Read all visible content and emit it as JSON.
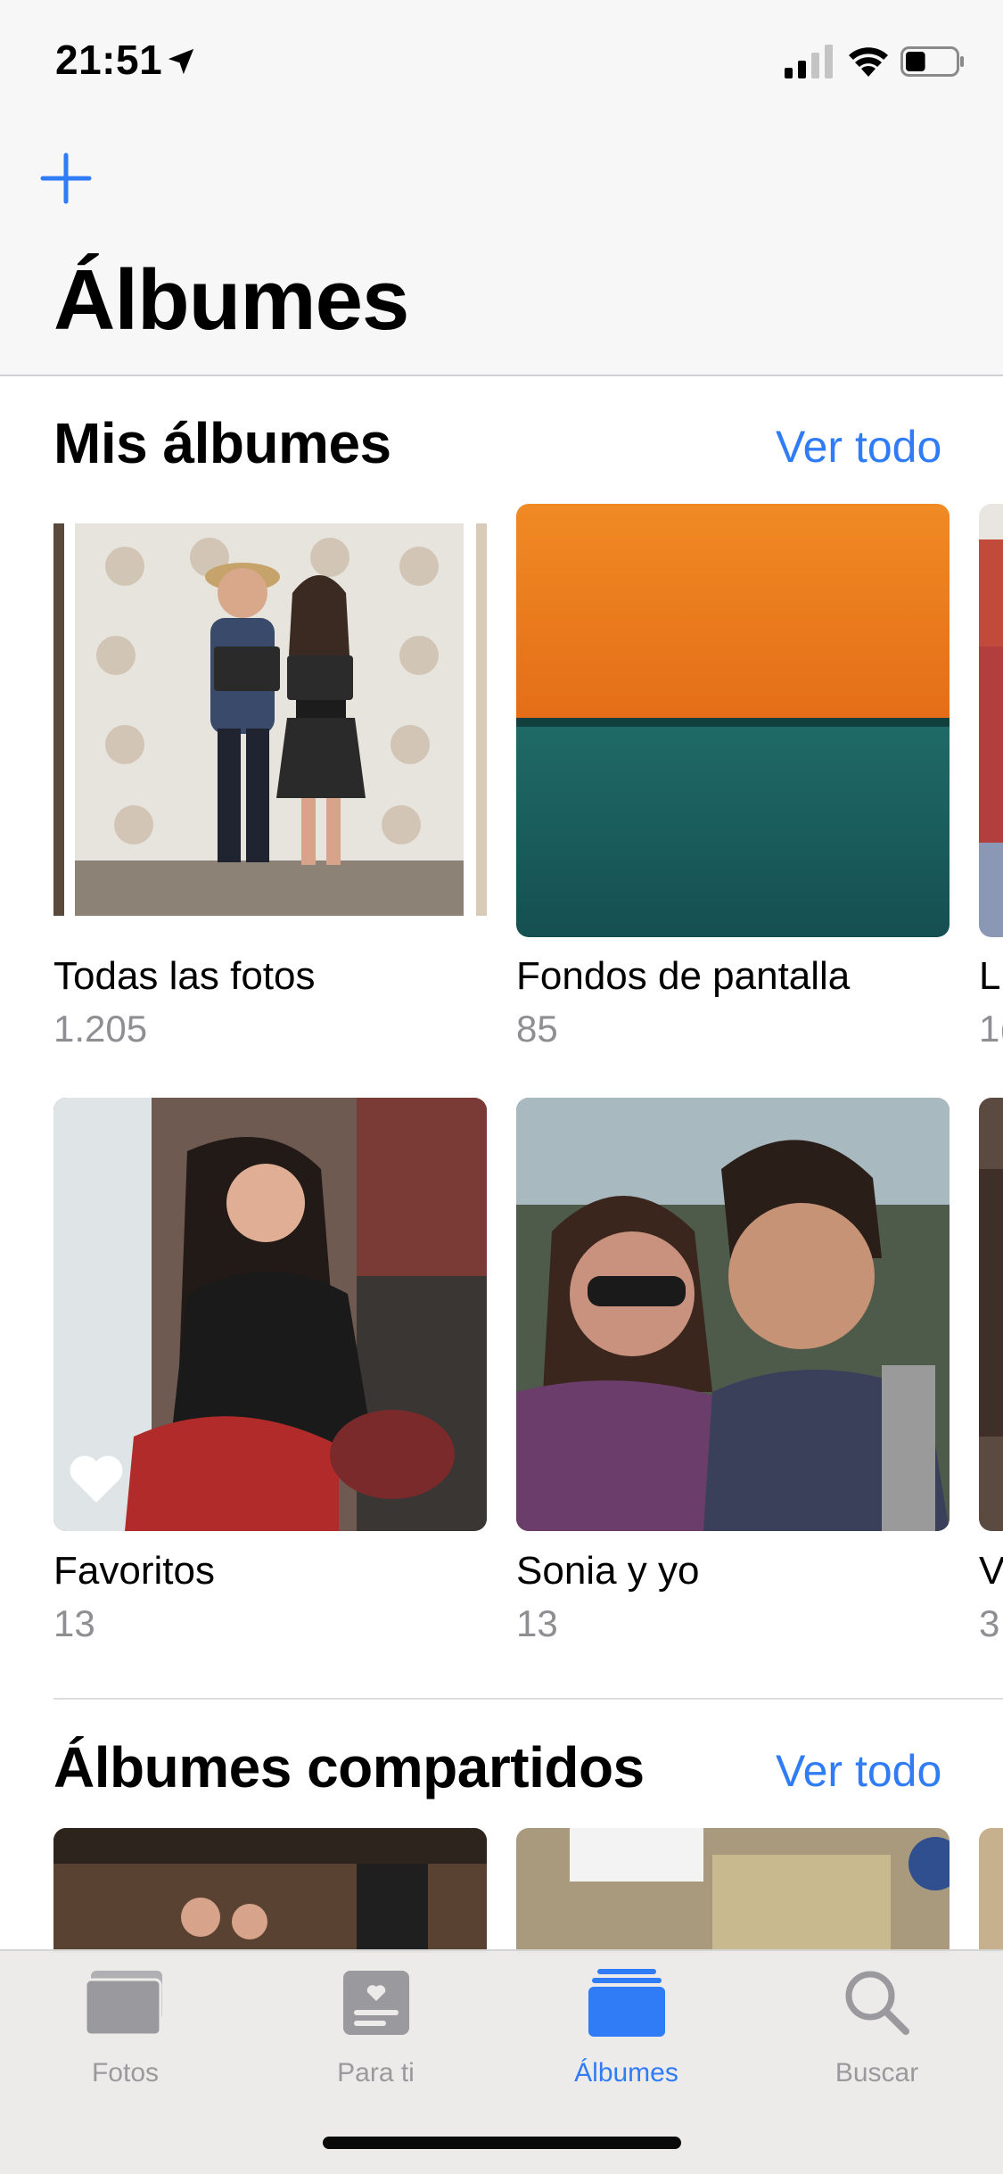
{
  "status_bar": {
    "time": "21:51",
    "battery_level": 0.4
  },
  "header": {
    "title": "Álbumes"
  },
  "my_albums": {
    "title": "Mis álbumes",
    "see_all": "Ver todo",
    "albums": [
      {
        "name": "Todas las fotos",
        "count": "1.205"
      },
      {
        "name": "Fondos de pantalla",
        "count": "85"
      },
      {
        "name": "L",
        "count": "1("
      },
      {
        "name": "Favoritos",
        "count": "13"
      },
      {
        "name": "Sonia y yo",
        "count": "13"
      },
      {
        "name": "V",
        "count": "3"
      }
    ]
  },
  "shared_albums": {
    "title": "Álbumes compartidos",
    "see_all": "Ver todo"
  },
  "tabbar": {
    "tabs": [
      {
        "label": "Fotos",
        "icon": "photos-icon"
      },
      {
        "label": "Para ti",
        "icon": "for-you-icon"
      },
      {
        "label": "Álbumes",
        "icon": "albums-icon",
        "active": true
      },
      {
        "label": "Buscar",
        "icon": "search-icon"
      }
    ]
  },
  "colors": {
    "accent": "#2f7cf6",
    "secondary_text": "#8e8e93"
  }
}
